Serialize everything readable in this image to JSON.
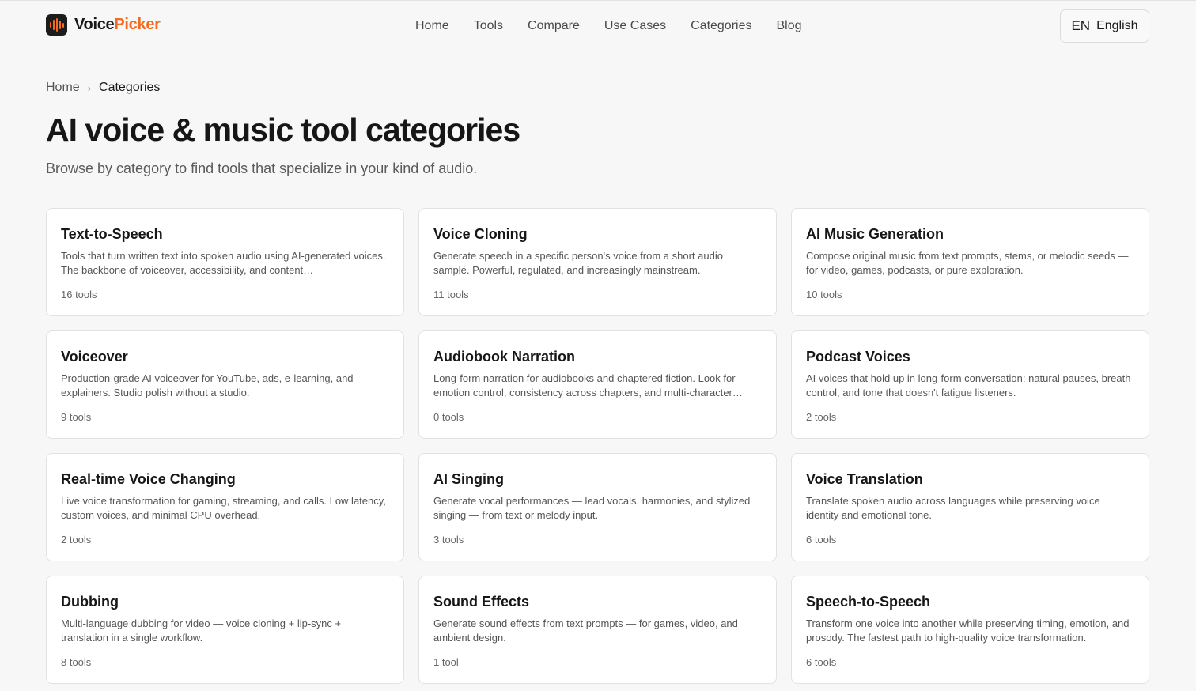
{
  "brand": {
    "name_part1": "Voice",
    "name_part2": "Picker",
    "accent_color": "#f26b21"
  },
  "nav": {
    "items": [
      {
        "label": "Home"
      },
      {
        "label": "Tools"
      },
      {
        "label": "Compare"
      },
      {
        "label": "Use Cases"
      },
      {
        "label": "Categories"
      },
      {
        "label": "Blog"
      }
    ]
  },
  "language": {
    "code": "EN",
    "label": "English"
  },
  "breadcrumb": {
    "home": "Home",
    "separator": "›",
    "current": "Categories"
  },
  "page": {
    "title": "AI voice & music tool categories",
    "subtitle": "Browse by category to find tools that specialize in your kind of audio."
  },
  "categories": [
    {
      "title": "Text-to-Speech",
      "desc": "Tools that turn written text into spoken audio using AI-generated voices. The backbone of voiceover, accessibility, and content…",
      "count": "16 tools"
    },
    {
      "title": "Voice Cloning",
      "desc": "Generate speech in a specific person's voice from a short audio sample. Powerful, regulated, and increasingly mainstream.",
      "count": "11 tools"
    },
    {
      "title": "AI Music Generation",
      "desc": "Compose original music from text prompts, stems, or melodic seeds — for video, games, podcasts, or pure exploration.",
      "count": "10 tools"
    },
    {
      "title": "Voiceover",
      "desc": "Production-grade AI voiceover for YouTube, ads, e-learning, and explainers. Studio polish without a studio.",
      "count": "9 tools"
    },
    {
      "title": "Audiobook Narration",
      "desc": "Long-form narration for audiobooks and chaptered fiction. Look for emotion control, consistency across chapters, and multi-character…",
      "count": "0 tools"
    },
    {
      "title": "Podcast Voices",
      "desc": "AI voices that hold up in long-form conversation: natural pauses, breath control, and tone that doesn't fatigue listeners.",
      "count": "2 tools"
    },
    {
      "title": "Real-time Voice Changing",
      "desc": "Live voice transformation for gaming, streaming, and calls. Low latency, custom voices, and minimal CPU overhead.",
      "count": "2 tools"
    },
    {
      "title": "AI Singing",
      "desc": "Generate vocal performances — lead vocals, harmonies, and stylized singing — from text or melody input.",
      "count": "3 tools"
    },
    {
      "title": "Voice Translation",
      "desc": "Translate spoken audio across languages while preserving voice identity and emotional tone.",
      "count": "6 tools"
    },
    {
      "title": "Dubbing",
      "desc": "Multi-language dubbing for video — voice cloning + lip-sync + translation in a single workflow.",
      "count": "8 tools"
    },
    {
      "title": "Sound Effects",
      "desc": "Generate sound effects from text prompts — for games, video, and ambient design.",
      "count": "1 tool"
    },
    {
      "title": "Speech-to-Speech",
      "desc": "Transform one voice into another while preserving timing, emotion, and prosody. The fastest path to high-quality voice transformation.",
      "count": "6 tools"
    }
  ]
}
